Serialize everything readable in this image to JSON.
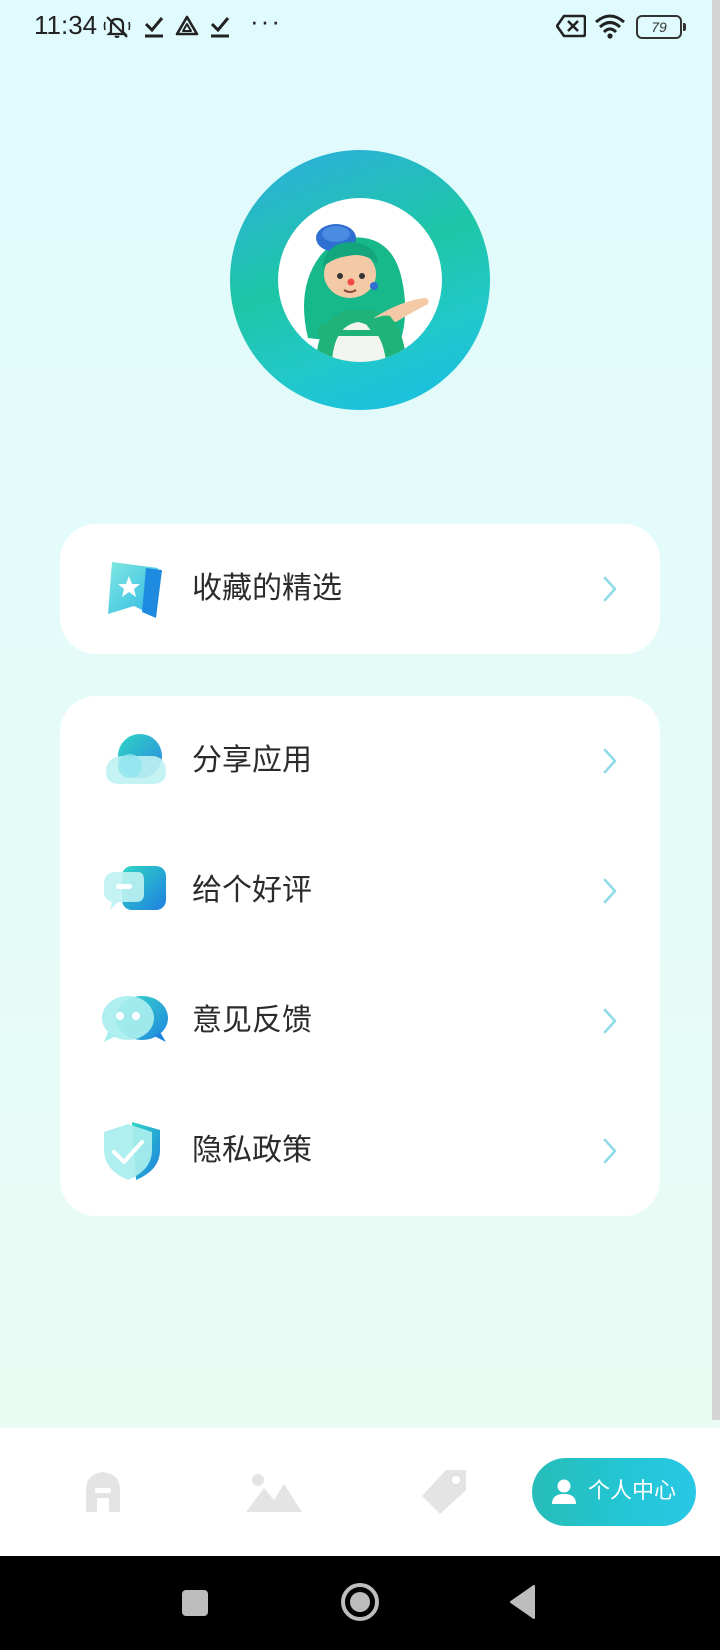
{
  "status_bar": {
    "time": "11:34",
    "icons": [
      "mute-icon",
      "check-icon",
      "triangle-logo-icon",
      "check-icon",
      "more-dots-icon",
      "sim-x-icon",
      "wifi-icon",
      "battery-icon"
    ],
    "dots": "···",
    "battery": "79"
  },
  "profile": {
    "avatar": "avatar-illustration",
    "ring_colors": [
      "#2eaee2",
      "#1ec6a6",
      "#18bde8"
    ]
  },
  "favorites": {
    "label": "收藏的精选",
    "icon": "bookmark-star-icon"
  },
  "menu": [
    {
      "label": "分享应用",
      "icon": "share-bubble-icon"
    },
    {
      "label": "给个好评",
      "icon": "rating-chat-icon"
    },
    {
      "label": "意见反馈",
      "icon": "feedback-chat-icon"
    },
    {
      "label": "隐私政策",
      "icon": "shield-check-icon"
    }
  ],
  "bottom_nav": {
    "items": [
      {
        "icon": "home-icon"
      },
      {
        "icon": "image-mountain-icon"
      },
      {
        "icon": "tag-icon"
      }
    ],
    "active": {
      "label": "个人中心",
      "icon": "person-icon"
    }
  },
  "colors": {
    "accent": "#23c6d6",
    "chevron": "#8fdbe8",
    "text": "#2b2b2b"
  }
}
